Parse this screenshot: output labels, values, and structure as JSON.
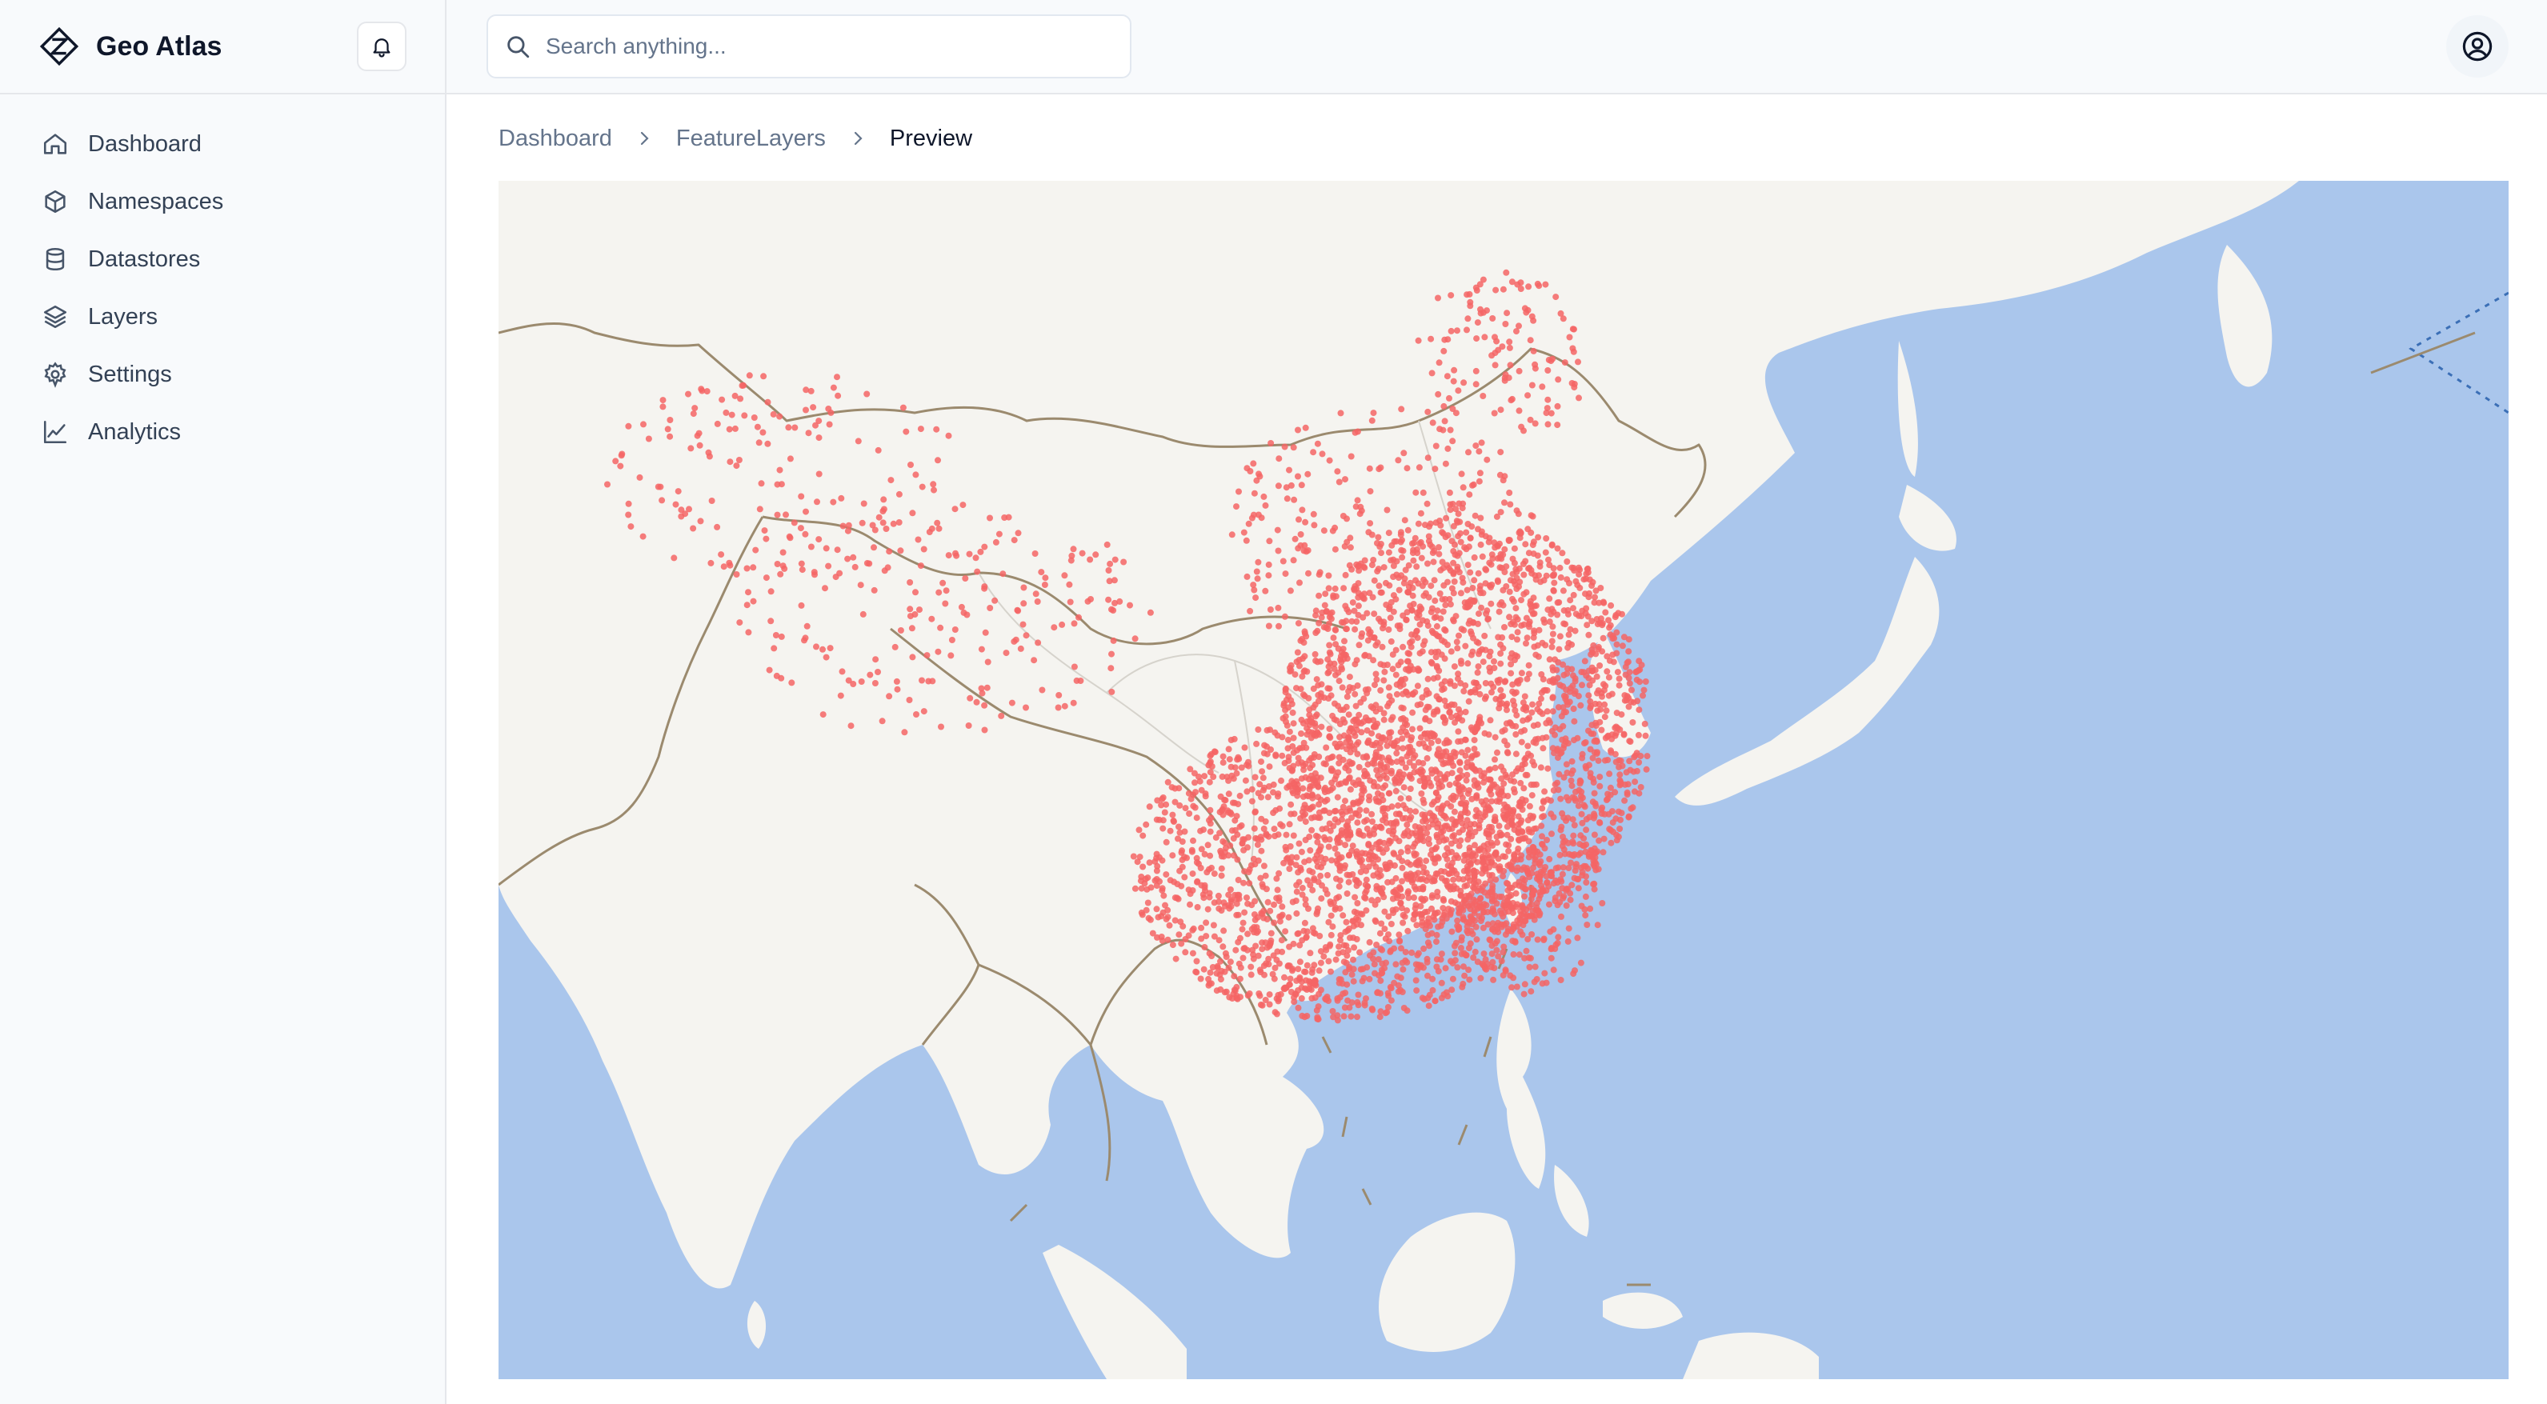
{
  "app": {
    "name": "Geo Atlas"
  },
  "icons": {
    "logo": "atlas-logo-icon",
    "notifications": "bell-icon",
    "search": "search-icon",
    "user": "user-circle-icon",
    "separator": "chevron-right-icon"
  },
  "sidebar": {
    "items": [
      {
        "label": "Dashboard",
        "icon": "home-icon"
      },
      {
        "label": "Namespaces",
        "icon": "cube-icon"
      },
      {
        "label": "Datastores",
        "icon": "database-icon"
      },
      {
        "label": "Layers",
        "icon": "layers-icon"
      },
      {
        "label": "Settings",
        "icon": "gear-icon"
      },
      {
        "label": "Analytics",
        "icon": "chart-line-icon"
      }
    ]
  },
  "search": {
    "placeholder": "Search anything..."
  },
  "breadcrumb": {
    "items": [
      "Dashboard",
      "FeatureLayers",
      "Preview"
    ]
  },
  "map": {
    "colors": {
      "water": "#aac6ec",
      "land": "#f5f4f0",
      "border": "#9b8a6e",
      "point": "#f56565"
    }
  }
}
